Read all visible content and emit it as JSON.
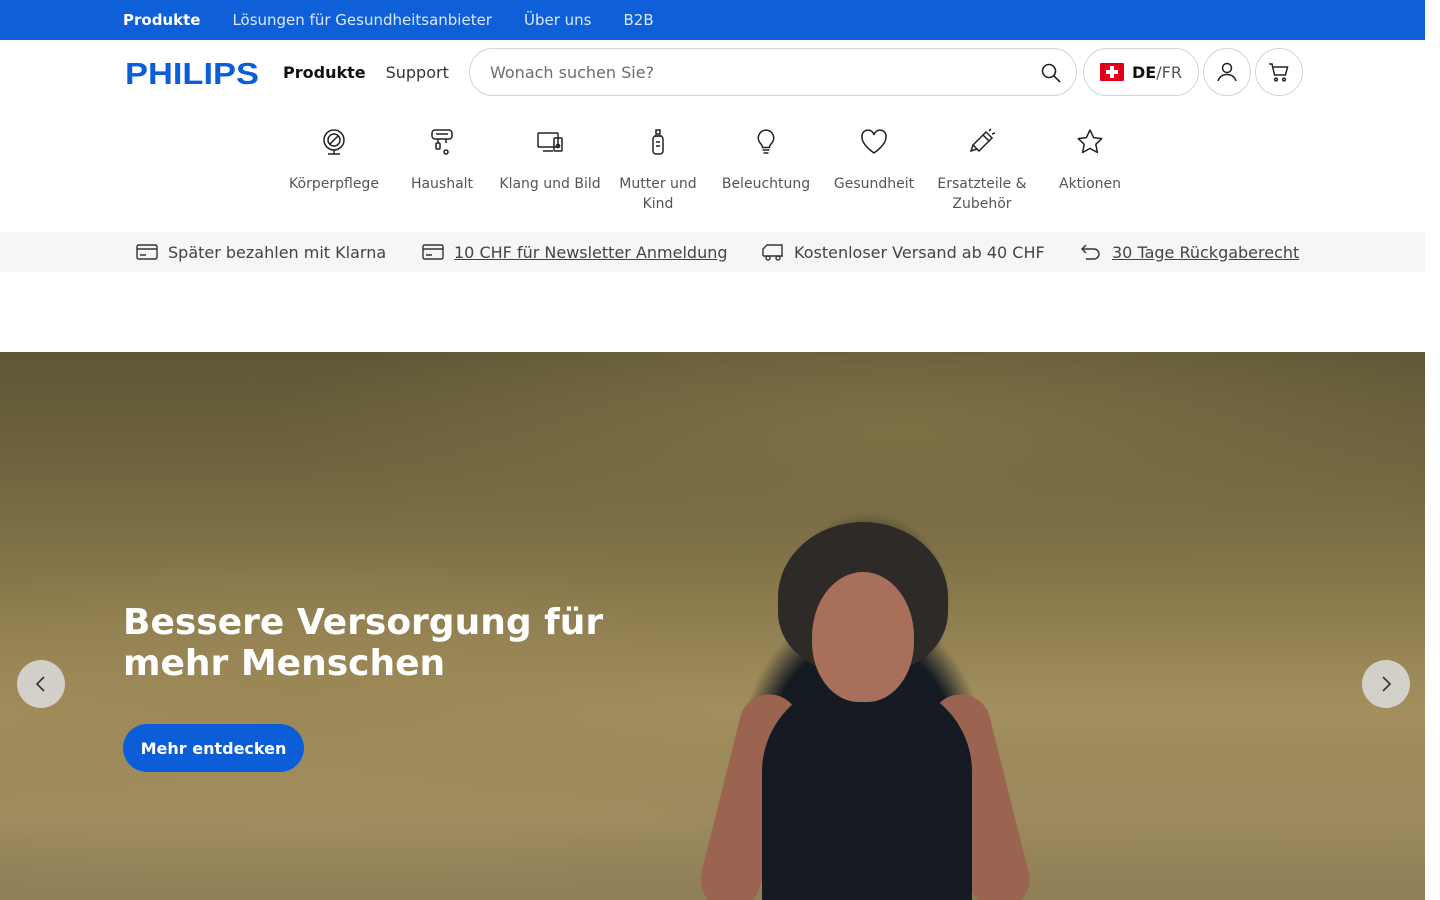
{
  "topbar": {
    "links": [
      "Produkte",
      "Lösungen für Gesundheitsanbieter",
      "Über uns",
      "B2B"
    ]
  },
  "header": {
    "logo_text": "PHILIPS",
    "nav": [
      "Produkte",
      "Support"
    ],
    "search_placeholder": "Wonach suchen Sie?",
    "lang_active": "DE",
    "lang_sep": "/",
    "lang_other": "FR"
  },
  "categories": [
    {
      "label": "Körperpflege",
      "icon": "personal-care-icon"
    },
    {
      "label": "Haushalt",
      "icon": "household-icon"
    },
    {
      "label": "Klang und Bild",
      "icon": "sound-vision-icon"
    },
    {
      "label": "Mutter und Kind",
      "icon": "baby-bottle-icon"
    },
    {
      "label": "Beleuchtung",
      "icon": "lightbulb-icon"
    },
    {
      "label": "Gesundheit",
      "icon": "heart-icon"
    },
    {
      "label": "Ersatzteile & Zubehör",
      "icon": "parts-icon"
    },
    {
      "label": "Aktionen",
      "icon": "star-icon"
    }
  ],
  "usp": [
    {
      "label": "Später bezahlen mit Klarna",
      "icon": "card-icon"
    },
    {
      "label": "10 CHF für Newsletter Anmeldung",
      "icon": "card-icon"
    },
    {
      "label": "Kostenloser Versand ab 40 CHF",
      "icon": "truck-icon"
    },
    {
      "label": "30 Tage Rückgaberecht",
      "icon": "return-icon"
    }
  ],
  "hero": {
    "title": "Bessere Versorgung für mehr Menschen",
    "cta": "Mehr entdecken"
  },
  "colors": {
    "brand_blue": "#0e5fd8",
    "logo_blue": "#0b5ed7"
  }
}
